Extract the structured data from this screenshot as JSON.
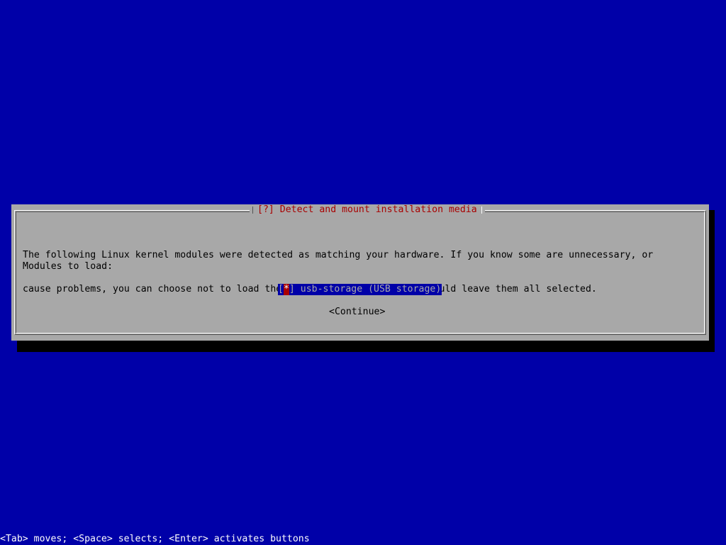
{
  "dialog": {
    "title": "[?] Detect and mount installation media",
    "description_lines": [
      "The following Linux kernel modules were detected as matching your hardware. If you know some are unnecessary, or",
      "cause problems, you can choose not to load them. If you're unsure, you should leave them all selected."
    ],
    "modules_label": "Modules to load:",
    "module_item": {
      "bracket_open": "[",
      "mark": "*",
      "bracket_close": "]",
      "label": " usb-storage (USB storage)",
      "checked": true
    },
    "continue_label": "<Continue>"
  },
  "help_line": "<Tab> moves; <Space> selects; <Enter> activates buttons",
  "colors": {
    "background": "#0000a8",
    "dialog_bg": "#a8a8a8",
    "title": "#a80000",
    "selected_bg": "#0000a8",
    "cursor_bg": "#a80000",
    "help_text": "#fcfcfc"
  }
}
